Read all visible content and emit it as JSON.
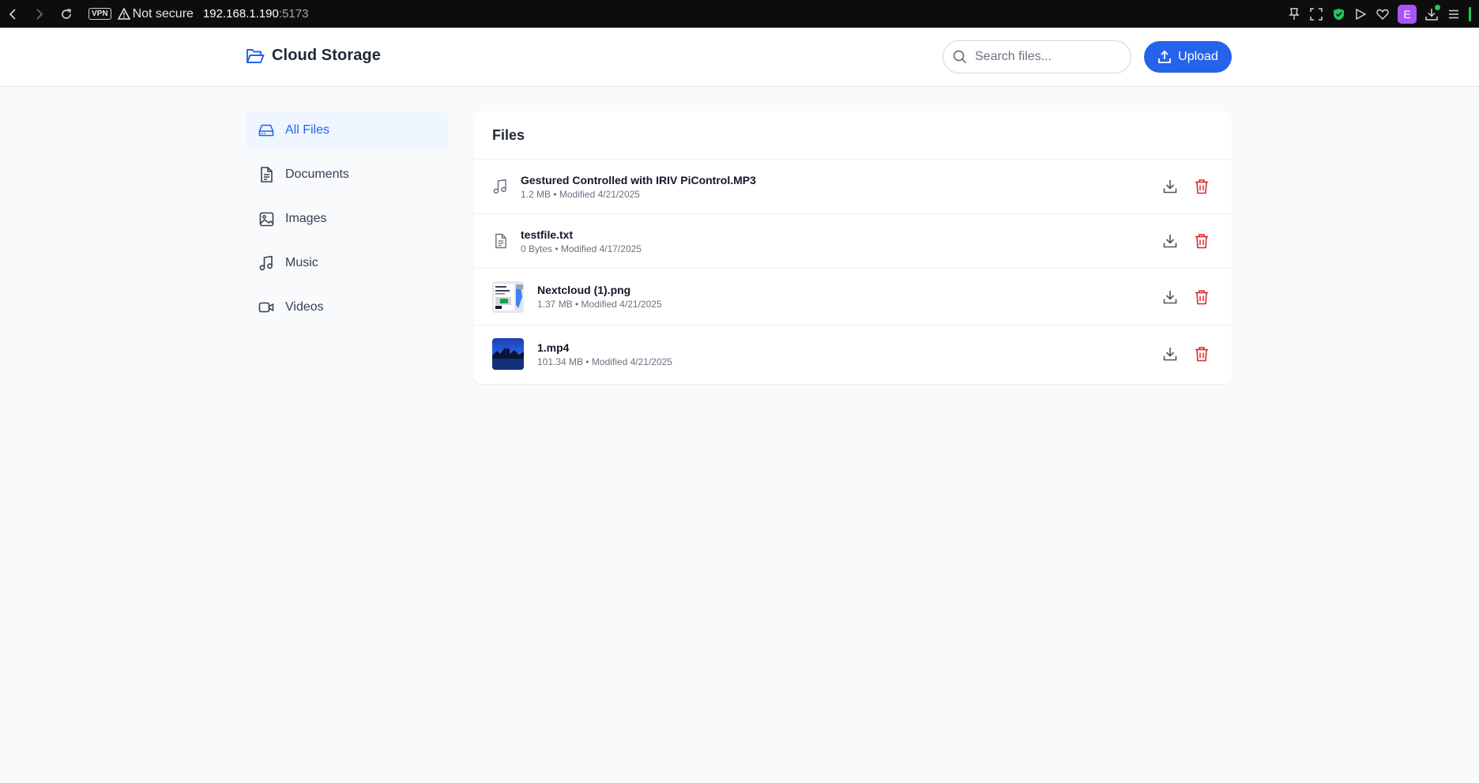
{
  "browser": {
    "vpn_label": "VPN",
    "security_text": "Not secure",
    "url_host": "192.168.1.190",
    "url_port": ":5173",
    "profile_initial": "E"
  },
  "header": {
    "app_title": "Cloud Storage",
    "search_placeholder": "Search files...",
    "upload_label": "Upload",
    "accent_color": "#2563eb"
  },
  "sidebar": {
    "items": [
      {
        "label": "All Files",
        "icon": "drive-icon",
        "active": true
      },
      {
        "label": "Documents",
        "icon": "document-icon",
        "active": false
      },
      {
        "label": "Images",
        "icon": "image-icon",
        "active": false
      },
      {
        "label": "Music",
        "icon": "music-icon",
        "active": false
      },
      {
        "label": "Videos",
        "icon": "video-icon",
        "active": false
      }
    ]
  },
  "main": {
    "title": "Files",
    "files": [
      {
        "name": "Gestured Controlled with IRIV PiControl.MP3",
        "meta": "1.2 MB • Modified 4/21/2025",
        "icon": "music-icon"
      },
      {
        "name": "testfile.txt",
        "meta": "0 Bytes • Modified 4/17/2025",
        "icon": "document-icon"
      },
      {
        "name": "Nextcloud (1).png",
        "meta": "1.37 MB • Modified 4/21/2025",
        "icon": "image-thumbnail"
      },
      {
        "name": "1.mp4",
        "meta": "101.34 MB • Modified 4/21/2025",
        "icon": "video-thumbnail"
      }
    ],
    "delete_color": "#dc2626"
  }
}
